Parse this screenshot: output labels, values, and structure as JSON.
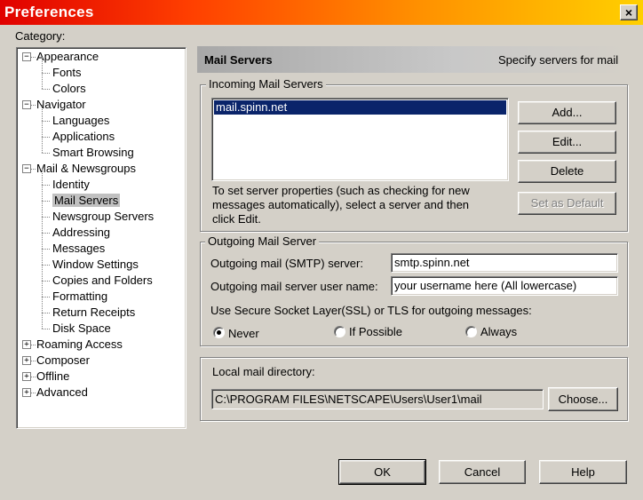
{
  "window": {
    "title": "Preferences",
    "close_glyph": "×"
  },
  "category": {
    "label": "Category:"
  },
  "tree": [
    {
      "label": "Appearance",
      "expander": "−"
    },
    {
      "label": "Fonts"
    },
    {
      "label": "Colors"
    },
    {
      "label": "Navigator",
      "expander": "−"
    },
    {
      "label": "Languages"
    },
    {
      "label": "Applications"
    },
    {
      "label": "Smart Browsing"
    },
    {
      "label": "Mail & Newsgroups",
      "expander": "−"
    },
    {
      "label": "Identity"
    },
    {
      "label": "Mail Servers",
      "selected": true
    },
    {
      "label": "Newsgroup Servers"
    },
    {
      "label": "Addressing"
    },
    {
      "label": "Messages"
    },
    {
      "label": "Window Settings"
    },
    {
      "label": "Copies and Folders"
    },
    {
      "label": "Formatting"
    },
    {
      "label": "Return Receipts"
    },
    {
      "label": "Disk Space"
    },
    {
      "label": "Roaming Access",
      "expander": "+"
    },
    {
      "label": "Composer",
      "expander": "+"
    },
    {
      "label": "Offline",
      "expander": "+"
    },
    {
      "label": "Advanced",
      "expander": "+"
    }
  ],
  "panel": {
    "title": "Mail Servers",
    "subtitle": "Specify servers for mail"
  },
  "incoming": {
    "legend": "Incoming Mail Servers",
    "servers": [
      "mail.spinn.net"
    ],
    "add": "Add...",
    "edit": "Edit...",
    "delete": "Delete",
    "set_default": "Set as Default",
    "help_text_1": "To set server properties (such as checking for new",
    "help_text_2": "messages automatically), select a server and then",
    "help_text_3": "click Edit."
  },
  "outgoing": {
    "legend": "Outgoing Mail Server",
    "smtp_label": "Outgoing mail (SMTP) server:",
    "smtp_value": "smtp.spinn.net",
    "user_label": "Outgoing mail server user name:",
    "user_value": "your username here (All lowercase)",
    "ssl_label": "Use Secure Socket Layer(SSL) or TLS for outgoing messages:",
    "ssl_options": [
      "Never",
      "If Possible",
      "Always"
    ],
    "ssl_selected": "Never"
  },
  "local": {
    "label": "Local mail directory:",
    "path": "C:\\PROGRAM FILES\\NETSCAPE\\Users\\User1\\mail",
    "choose": "Choose..."
  },
  "buttons": {
    "ok": "OK",
    "cancel": "Cancel",
    "help": "Help"
  }
}
